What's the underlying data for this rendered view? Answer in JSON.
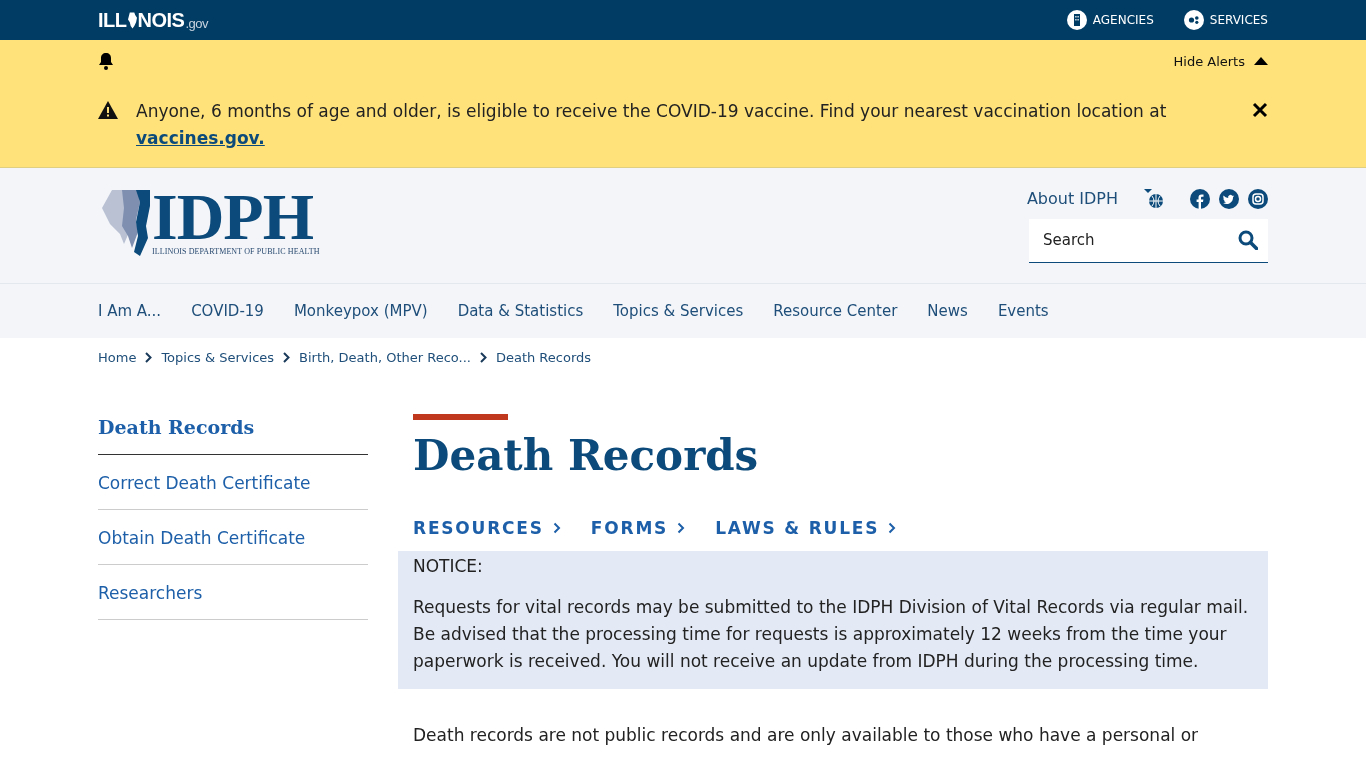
{
  "topbar": {
    "brand": {
      "prefix": "ILL",
      "suffix": "NOIS",
      "domain": ".gov"
    },
    "links": [
      {
        "label": "AGENCIES",
        "kind": "building"
      },
      {
        "label": "SERVICES",
        "kind": "gears"
      }
    ]
  },
  "alert_bar": {
    "hide_label": "Hide Alerts",
    "message": "Anyone, 6 months of age and older, is eligible to receive the COVID-19 vaccine. Find your nearest vaccination location at",
    "link": "vaccines.gov."
  },
  "header": {
    "logo": {
      "title": "IDPH",
      "subtitle": "ILLINOIS DEPARTMENT OF PUBLIC HEALTH"
    },
    "about": "About IDPH",
    "search": {
      "placeholder": "Search"
    }
  },
  "nav": [
    "I Am A...",
    "COVID-19",
    "Monkeypox (MPV)",
    "Data & Statistics",
    "Topics & Services",
    "Resource Center",
    "News",
    "Events"
  ],
  "breadcrumb": [
    "Home",
    "Topics & Services",
    "Birth, Death, Other Reco...",
    "Death Records"
  ],
  "sidebar": {
    "title": "Death Records",
    "items": [
      "Correct Death Certificate",
      "Obtain Death Certificate",
      "Researchers"
    ]
  },
  "content": {
    "title": "Death Records",
    "quick_links": [
      "RESOURCES",
      "FORMS",
      "LAWS & RULES"
    ],
    "notice": {
      "heading": "NOTICE:",
      "text": "Requests for vital records may be submitted to the IDPH Division of Vital Records via regular mail. Be advised that the processing time for requests is approximately 12 weeks from the time your paperwork is received. You will not receive an update from IDPH during the processing time."
    },
    "paragraph": "Death records are not public records and are only available to those who have a personal or"
  }
}
